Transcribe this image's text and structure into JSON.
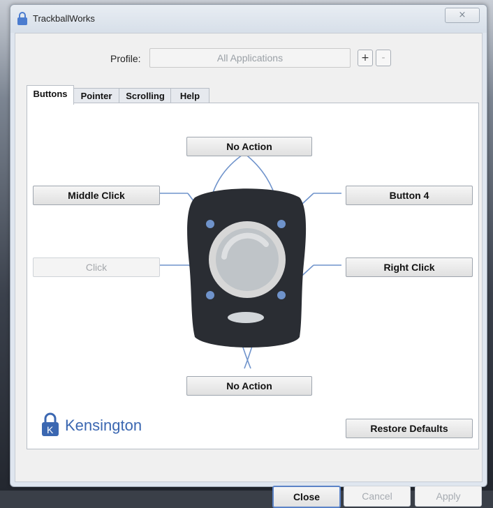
{
  "window": {
    "title": "TrackballWorks",
    "close_icon": "×"
  },
  "profile": {
    "label": "Profile:",
    "value": "All Applications",
    "add_label": "+",
    "remove_label": "-"
  },
  "tabs": [
    {
      "label": "Buttons",
      "active": true
    },
    {
      "label": "Pointer",
      "active": false
    },
    {
      "label": "Scrolling",
      "active": false
    },
    {
      "label": "Help",
      "active": false
    }
  ],
  "mapping": {
    "top": "No Action",
    "upper_left": "Middle Click",
    "upper_right": "Button 4",
    "lower_left": "Click",
    "lower_right": "Right Click",
    "bottom": "No Action"
  },
  "brand": {
    "name": "Kensington"
  },
  "actions": {
    "restore": "Restore Defaults",
    "close": "Close",
    "cancel": "Cancel",
    "apply": "Apply"
  },
  "colors": {
    "accent": "#5b83c7",
    "trackball_body": "#2a2d33",
    "ring": "#d7d7d7",
    "ball": "#bfc4c8"
  },
  "icons": {
    "window_icon": "lock-icon",
    "logo_icon": "kensington-lock-icon"
  }
}
